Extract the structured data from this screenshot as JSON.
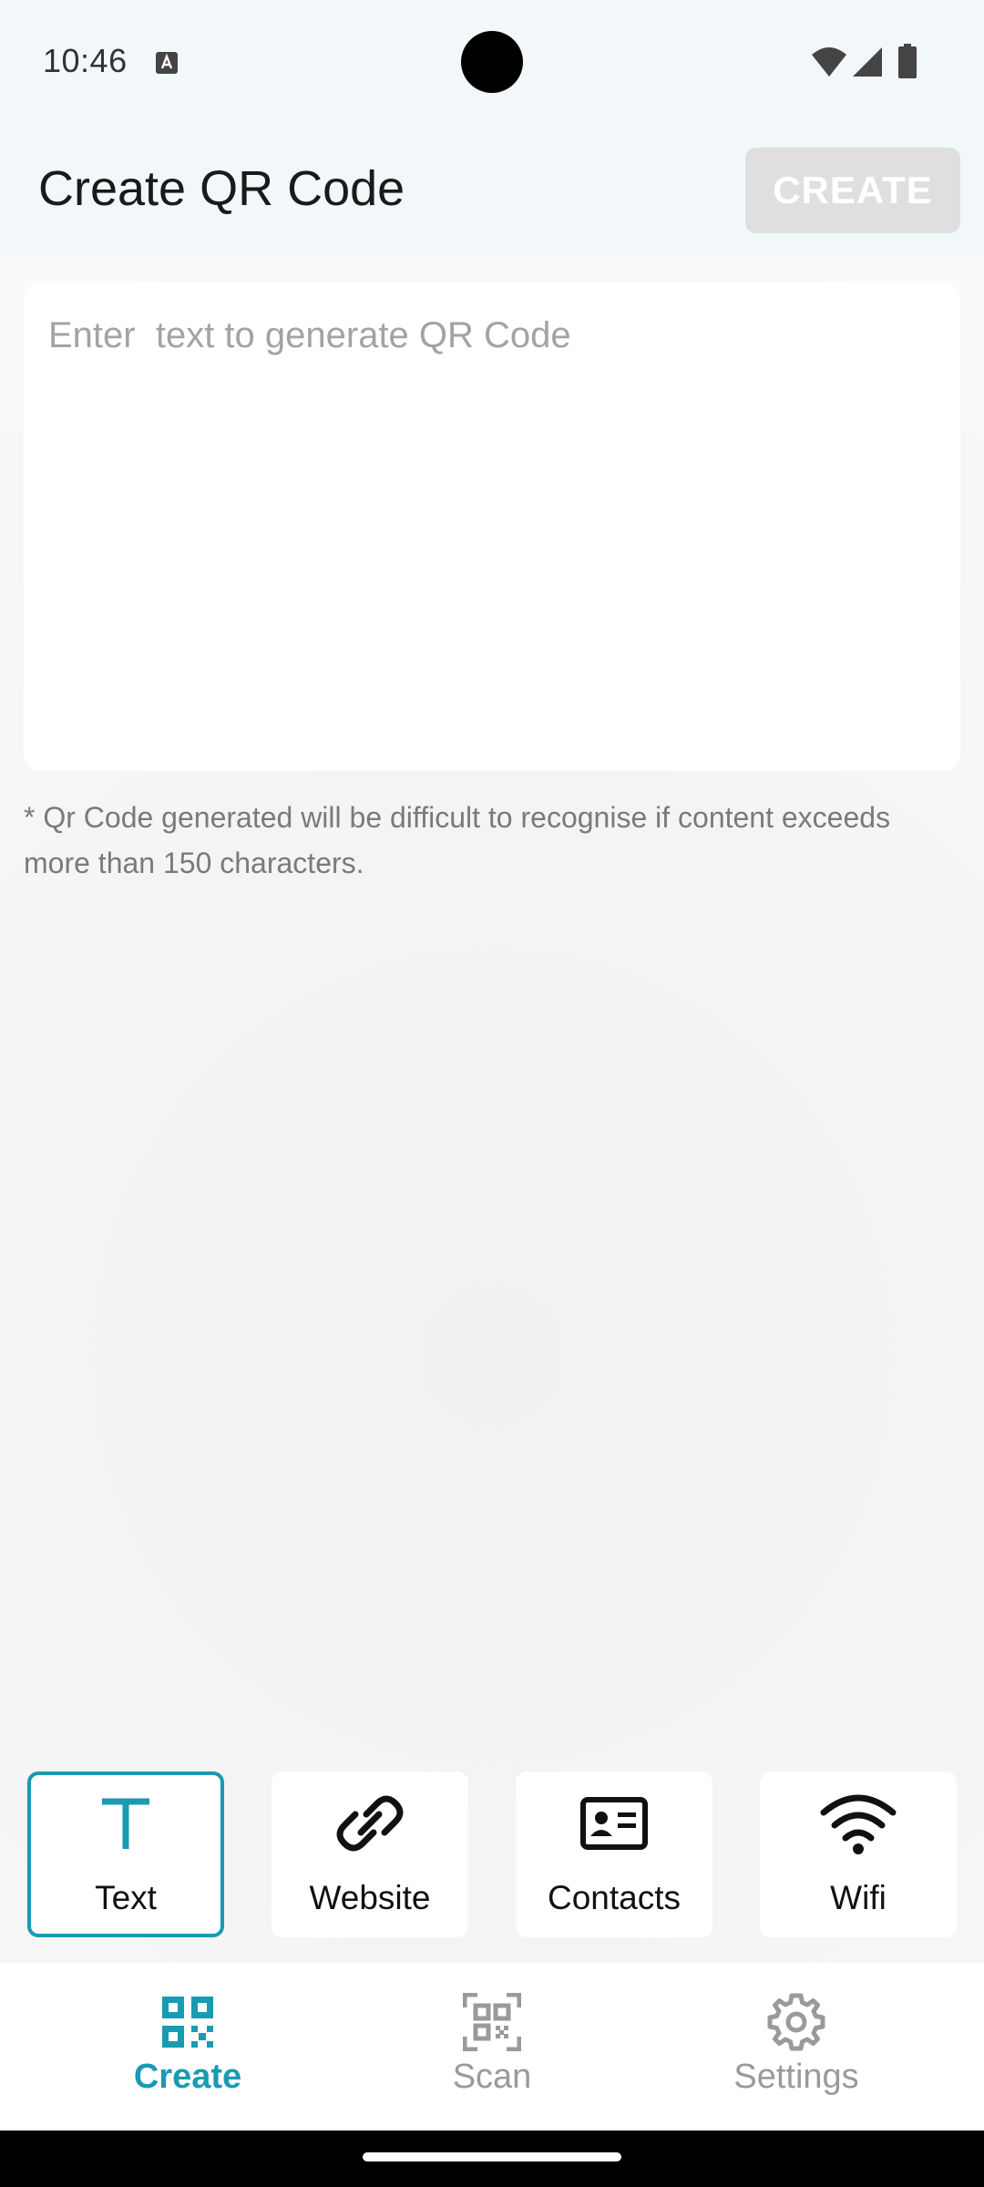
{
  "status_bar": {
    "time": "10:46"
  },
  "app_bar": {
    "title": "Create QR Code",
    "create_label": "CREATE"
  },
  "input": {
    "placeholder": "Enter  text to generate QR Code",
    "value": ""
  },
  "hint": "* Qr Code generated will be difficult to recognise if content exceeds more than 150 characters.",
  "types": [
    {
      "label": "Text",
      "icon": "text-icon",
      "selected": true
    },
    {
      "label": "Website",
      "icon": "link-icon",
      "selected": false
    },
    {
      "label": "Contacts",
      "icon": "contact-card-icon",
      "selected": false
    },
    {
      "label": "Wifi",
      "icon": "wifi-icon",
      "selected": false
    }
  ],
  "nav": [
    {
      "label": "Create",
      "icon": "qr-code-icon",
      "active": true
    },
    {
      "label": "Scan",
      "icon": "scan-qr-icon",
      "active": false
    },
    {
      "label": "Settings",
      "icon": "gear-icon",
      "active": false
    }
  ],
  "colors": {
    "accent": "#1a9ab3",
    "disabled_button": "#dfdfdf",
    "inactive_nav": "#9a9a9a",
    "header_background": "#f2f7fa"
  }
}
